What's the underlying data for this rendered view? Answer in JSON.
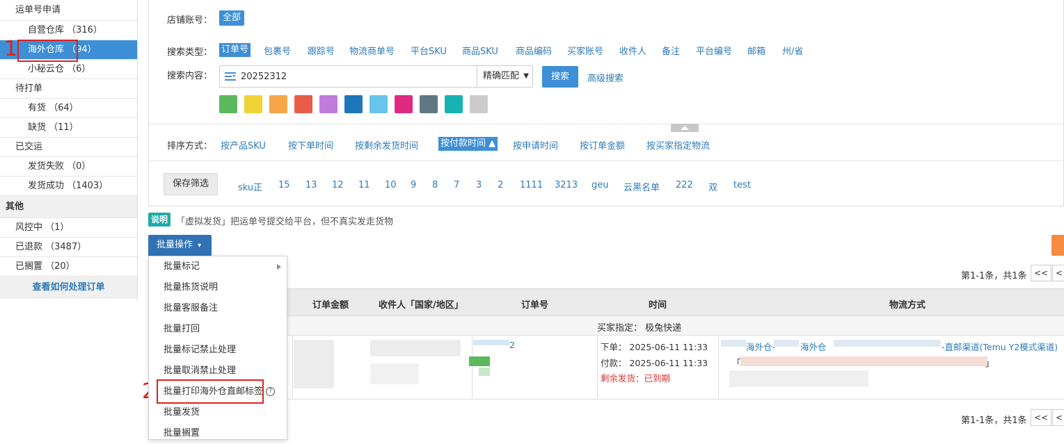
{
  "sidebar": {
    "items": [
      {
        "label": "运单号申请",
        "level": 1
      },
      {
        "label": "自营仓库 （316）",
        "level": 2
      },
      {
        "label": "海外仓库 （94）",
        "level": 2,
        "active": true
      },
      {
        "label": "小秘云仓 （6）",
        "level": 2
      },
      {
        "label": "待打单",
        "level": 1
      },
      {
        "label": "有货 （64）",
        "level": 2
      },
      {
        "label": "缺货 （11）",
        "level": 2
      },
      {
        "label": "已交运",
        "level": 1
      },
      {
        "label": "发货失败 （0）",
        "level": 2
      },
      {
        "label": "发货成功 （1403）",
        "level": 2
      },
      {
        "label": "其他",
        "level": 0
      },
      {
        "label": "风控中 （1）",
        "level": 1
      },
      {
        "label": "已退款 （3487）",
        "level": 1
      },
      {
        "label": "已搁置 （20）",
        "level": 1
      }
    ],
    "help_link": "查看如何处理订单"
  },
  "annotations": {
    "one": "1",
    "two": "2"
  },
  "filters": {
    "shop_label": "店铺账号：",
    "shop_all": "全部",
    "search_type_label": "搜索类型：",
    "search_types": [
      "订单号",
      "包裹号",
      "跟踪号",
      "物流商单号",
      "平台SKU",
      "商品SKU",
      "商品编码",
      "买家账号",
      "收件人",
      "备注",
      "平台编号",
      "邮箱",
      "州/省"
    ],
    "search_content_label": "搜索内容：",
    "search_value": "20252312",
    "match_mode": "精确匹配",
    "search_button": "搜索",
    "advanced_search": "高级搜索",
    "color_tags": [
      "#5cb85c",
      "#f0d234",
      "#f7a647",
      "#e95c48",
      "#c17bdc",
      "#1f77bb",
      "#67c4ea",
      "#e02a80",
      "#607884",
      "#16b3b2",
      "#cccccc"
    ],
    "sort_label": "排序方式：",
    "sort_options": [
      "按产品SKU",
      "按下单时间",
      "按剩余发货时间",
      "按付款时间 ▲",
      "按申请时间",
      "按订单金额",
      "按买家指定物流"
    ],
    "save_filter": "保存筛选",
    "saved_filters": [
      "sku正",
      "15",
      "13",
      "12",
      "11",
      "10",
      "9",
      "8",
      "7",
      "3",
      "2",
      "1111",
      "3213",
      "geu",
      "云黑名单",
      "222",
      "双",
      "test"
    ]
  },
  "notice": {
    "badge": "说明",
    "text": "「虚拟发货」把运单号提交给平台，但不真实发走货物"
  },
  "bulk": {
    "button": "批量操作",
    "menu": [
      "批量标记",
      "批量拣货说明",
      "批量客服备注",
      "批量打回",
      "批量标记禁止处理",
      "批量取消禁止处理",
      "批量打印海外仓直邮标签",
      "批量发货",
      "批量搁置"
    ]
  },
  "pager": {
    "summary": "第1-1条，共1条",
    "first": "<<",
    "prev": "<"
  },
  "table": {
    "headers": [
      "订单金额",
      "收件人「国家/地区」",
      "订单号",
      "时间",
      "物流方式"
    ],
    "buyer_designated": "买家指定：  极兔快递",
    "row": {
      "order_no_suffix": "2",
      "order_time": "下单：  2025-06-11 11:33",
      "pay_time": "付款：  2025-06-11 11:33",
      "remaining": "剩余发货：已到期",
      "ship_a": "海外仓-",
      "ship_b": "海外仓",
      "ship_c": "-直邮渠道(Temu Y2模式渠道)",
      "addr_open": "「",
      "addr_close": "」"
    }
  }
}
